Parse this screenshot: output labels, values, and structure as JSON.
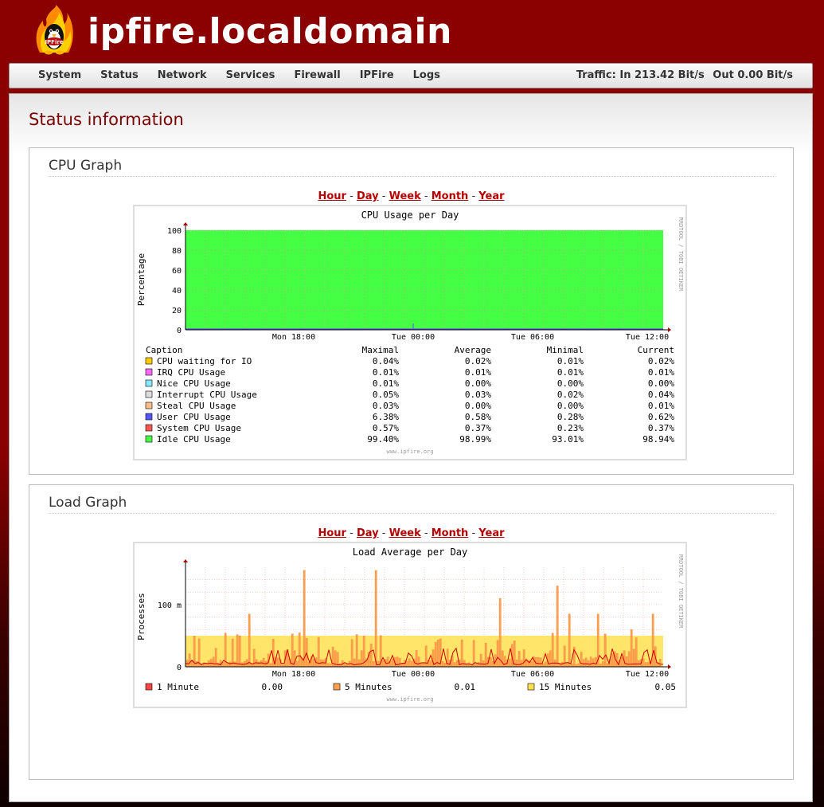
{
  "header": {
    "title": "ipfire.localdomain",
    "logo_icon": "ipfire-penguin-flame-logo",
    "logo_text": "IPFire"
  },
  "nav": {
    "items": [
      "System",
      "Status",
      "Network",
      "Services",
      "Firewall",
      "IPFire",
      "Logs"
    ],
    "traffic_label": "Traffic: In 213.42 Bit/s",
    "traffic_out": "Out 0.00 Bit/s"
  },
  "page": {
    "title": "Status information"
  },
  "cpu_box": {
    "title": "CPU Graph",
    "ranges": [
      "Hour",
      "Day",
      "Week",
      "Month",
      "Year"
    ],
    "separator": "-"
  },
  "load_box": {
    "title": "Load Graph",
    "ranges": [
      "Hour",
      "Day",
      "Week",
      "Month",
      "Year"
    ],
    "separator": "-"
  },
  "colors": {
    "header_bg": "#8b0000",
    "link": "#b40000",
    "idle_green": "#44ff44",
    "load_1min": "#ff4444",
    "load_5min": "#ffa050",
    "load_15min": "#ffe050"
  },
  "chart_data": [
    {
      "type": "area",
      "title": "CPU Usage per Day",
      "ylabel": "Percentage",
      "side_label": "RRDTOOL / TOBI OETIKER",
      "footer": "www.ipfire.org",
      "ylim": [
        0,
        100
      ],
      "yticks": [
        "0",
        "20",
        "40",
        "60",
        "80",
        "100"
      ],
      "xticks": [
        "Mon 18:00",
        "Tue 00:00",
        "Tue 06:00",
        "Tue 12:00"
      ],
      "legend_header": [
        "Caption",
        "Maximal",
        "Average",
        "Minimal",
        "Current"
      ],
      "series": [
        {
          "name": "CPU waiting for IO",
          "color": "#ffcc00",
          "stats": [
            "0.04%",
            "0.02%",
            "0.01%",
            "0.02%"
          ]
        },
        {
          "name": "IRQ CPU Usage",
          "color": "#ff66ff",
          "stats": [
            "0.01%",
            "0.01%",
            "0.01%",
            "0.01%"
          ]
        },
        {
          "name": "Nice CPU Usage",
          "color": "#88e8ff",
          "stats": [
            "0.01%",
            "0.00%",
            "0.00%",
            "0.00%"
          ]
        },
        {
          "name": "Interrupt CPU Usage",
          "color": "#dddddd",
          "stats": [
            "0.05%",
            "0.03%",
            "0.02%",
            "0.04%"
          ]
        },
        {
          "name": "Steal CPU Usage",
          "color": "#ffbb88",
          "stats": [
            "0.03%",
            "0.00%",
            "0.00%",
            "0.01%"
          ]
        },
        {
          "name": "User CPU Usage",
          "color": "#5555ff",
          "stats": [
            "6.38%",
            "0.58%",
            "0.28%",
            "0.62%"
          ]
        },
        {
          "name": "System CPU Usage",
          "color": "#ff5555",
          "stats": [
            "0.57%",
            "0.37%",
            "0.23%",
            "0.37%"
          ]
        },
        {
          "name": "Idle CPU Usage",
          "color": "#44ff44",
          "stats": [
            "99.40%",
            "98.99%",
            "93.01%",
            "98.94%"
          ]
        }
      ]
    },
    {
      "type": "area",
      "title": "Load Average per Day",
      "ylabel": "Processes",
      "side_label": "RRDTOOL / TOBI OETIKER",
      "footer": "www.ipfire.org",
      "ylim": [
        0,
        0.16
      ],
      "yticks": [
        "0",
        "100 m"
      ],
      "xticks": [
        "Mon 18:00",
        "Tue 00:00",
        "Tue 06:00",
        "Tue 12:00"
      ],
      "series": [
        {
          "name": "1 Minute",
          "color": "#ff4444",
          "current": "0.00"
        },
        {
          "name": "5 Minutes",
          "color": "#ffa050",
          "current": "0.01"
        },
        {
          "name": "15 Minutes",
          "color": "#ffe050",
          "current": "0.05"
        }
      ]
    }
  ]
}
